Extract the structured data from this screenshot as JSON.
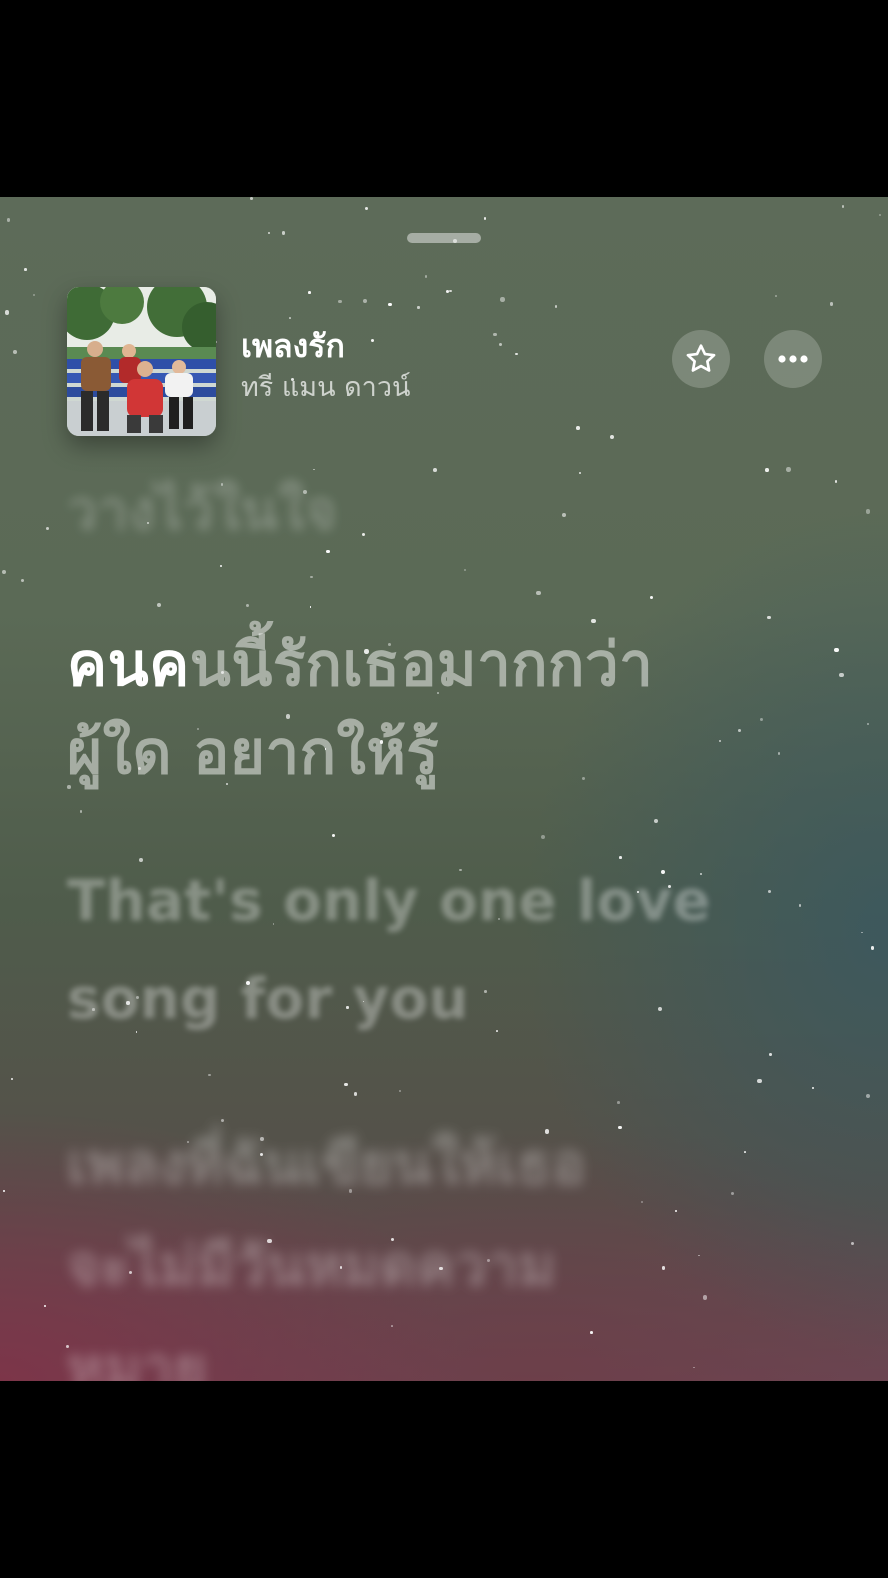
{
  "now_playing": {
    "title": "เพลงรัก",
    "artist": "ทรี แมน ดาวน์",
    "artwork_icon": "album-artwork-image"
  },
  "actions": {
    "favorite_icon": "star-icon",
    "more_icon": "ellipsis-icon"
  },
  "lyrics": {
    "previous_line": "วางไว้ในใจ",
    "current": {
      "sung_part": "คนค",
      "unsung_part": "นนี้รักเธอมากกว่า",
      "line2": "ผู้ใด อยากให้รู้"
    },
    "upcoming_line1": "That's only one love",
    "upcoming_line2": "song for you",
    "later_line1": "เพลงที่ฉันเขียนให้เธอ",
    "later_line2": "จะไม่มีวันหมดความ",
    "later_line3": "หมาย"
  },
  "colors": {
    "background_top": "#5d6b59",
    "background_bottom_left": "#7d3448",
    "background_right": "#3a5860",
    "lyric_active": "#ffffff"
  }
}
